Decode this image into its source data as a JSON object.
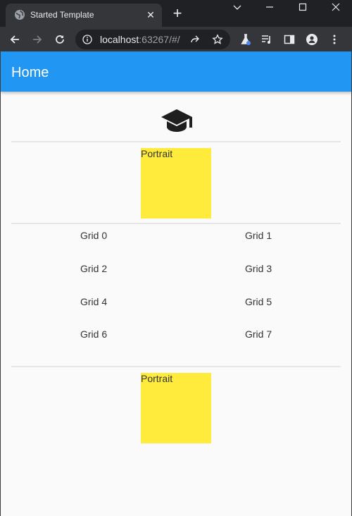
{
  "browser": {
    "tab_title": "Started Template",
    "url_host": "localhost",
    "url_rest": ":63267/#/"
  },
  "app": {
    "title": "Home",
    "accent_color": "#2196f3",
    "header_icon": "school-icon"
  },
  "portrait_label": "Portrait",
  "grid": [
    "Grid 0",
    "Grid 1",
    "Grid 2",
    "Grid 3",
    "Grid 4",
    "Grid 5",
    "Grid 6",
    "Grid 7"
  ],
  "colors": {
    "portrait_box": "#ffeb3b"
  }
}
